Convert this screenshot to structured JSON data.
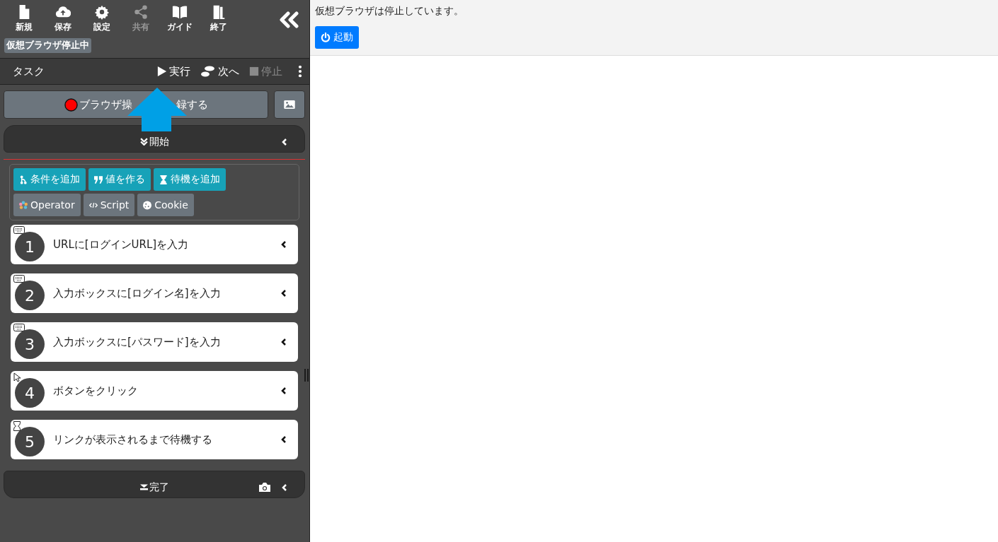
{
  "toolbar": [
    {
      "label": "新規",
      "disabled": false
    },
    {
      "label": "保存",
      "disabled": false
    },
    {
      "label": "設定",
      "disabled": false
    },
    {
      "label": "共有",
      "disabled": true
    },
    {
      "label": "ガイド",
      "disabled": false
    },
    {
      "label": "終了",
      "disabled": false
    }
  ],
  "status_badge": "仮想ブラウザ停止中",
  "task_bar": {
    "title": "タスク",
    "actions": [
      {
        "label": "実行",
        "disabled": false
      },
      {
        "label": "次へ",
        "disabled": false
      },
      {
        "label": "停止",
        "disabled": true
      }
    ]
  },
  "record_button": {
    "label_start": "ブラウザ操",
    "label_end": "録する"
  },
  "start_block": {
    "label": "開始"
  },
  "add_buttons": [
    {
      "label": "条件を追加",
      "kind": "primary"
    },
    {
      "label": "値を作る",
      "kind": "primary"
    },
    {
      "label": "待機を追加",
      "kind": "primary"
    },
    {
      "label": "Operator",
      "kind": "secondary"
    },
    {
      "label": "Script",
      "kind": "secondary"
    },
    {
      "label": "Cookie",
      "kind": "secondary"
    }
  ],
  "steps": [
    {
      "number": "1",
      "label": "URLに[ログインURL]を入力",
      "kind": "keyboard"
    },
    {
      "number": "2",
      "label": "入力ボックスに[ログイン名]を入力",
      "kind": "keyboard"
    },
    {
      "number": "3",
      "label": "入力ボックスに[パスワード]を入力",
      "kind": "keyboard"
    },
    {
      "number": "4",
      "label": "ボタンをクリック",
      "kind": "click"
    },
    {
      "number": "5",
      "label": "リンクが表示されるまで待機する",
      "kind": "wait"
    }
  ],
  "end_block": {
    "label": "完了"
  },
  "browser_panel": {
    "message": "仮想ブラウザは停止しています。",
    "start_button": "起動"
  }
}
